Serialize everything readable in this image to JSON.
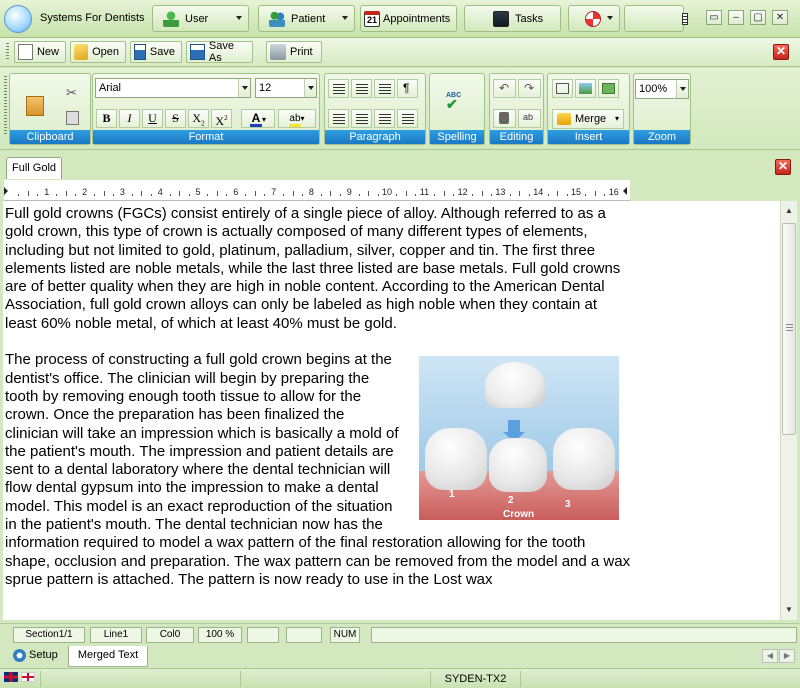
{
  "app": {
    "title": "Systems For Dentists",
    "menu": [
      {
        "label": "User",
        "icon": "user-icon"
      },
      {
        "label": "Patient",
        "icon": "patient-icon"
      },
      {
        "label": "Appointments",
        "icon": "calendar-icon",
        "calendar_day": "21"
      },
      {
        "label": "Tasks",
        "icon": "tasks-icon"
      }
    ]
  },
  "toolbar": {
    "new_label": "New",
    "open_label": "Open",
    "save_label": "Save",
    "save_as_label": "Save As",
    "print_label": "Print"
  },
  "ribbon": {
    "font_name": "Arial",
    "font_size": "12",
    "zoom_value": "100%",
    "merge_label": "Merge",
    "spelling_icon_text": "ABC",
    "groups": {
      "clipboard": "Clipboard",
      "format": "Format",
      "paragraph": "Paragraph",
      "spelling": "Spelling",
      "editing": "Editing",
      "insert": "Insert",
      "zoom": "Zoom"
    },
    "format_buttons": {
      "bold": "B",
      "italic": "I",
      "underline": "U",
      "strike": "S",
      "subscript": "X",
      "superscript": "X",
      "highlight": "ab"
    }
  },
  "document": {
    "tab_label": "Full Gold",
    "ruler_numbers": [
      "1",
      "2",
      "3",
      "4",
      "5",
      "6",
      "7",
      "8",
      "9",
      "10",
      "11",
      "12",
      "13",
      "14",
      "15",
      "16"
    ],
    "paragraph1": "Full gold crowns (FGCs) consist entirely of a single piece of alloy. Although referred to as a gold crown, this type of crown is actually composed of many different types of elements, including but not limited to gold, platinum, palladium, silver, copper and tin. The first three elements listed are noble metals, while the last three listed are base metals. Full gold crowns are of better quality when they are high in noble content. According to the American Dental Association, full gold crown alloys can only be labeled as high noble when they contain at least 60% noble metal, of which at least 40% must be gold.",
    "paragraph2": "The process of constructing a full gold crown begins at the dentist's office. The clinician will begin by preparing the tooth by removing enough tooth tissue to allow for the crown. Once the preparation has been finalized the clinician will take an impression which is basically a mold of the patient's mouth. The impression and patient details are sent to a dental laboratory where the dental technician will flow dental gypsum into the impression to make a dental model. This model is an exact reproduction of the situation in the patient's mouth. The dental technician now has the information required to model a wax pattern of the final restoration allowing for the tooth shape, occlusion and preparation. The wax pattern can be removed from the model and a wax sprue pattern is attached. The pattern is now ready to use in the Lost wax",
    "figure": {
      "label_1": "1",
      "label_2": "2",
      "label_3": "3",
      "caption": "Crown"
    }
  },
  "status": {
    "section": "Section1/1",
    "line": "Line1",
    "col": "Col0",
    "zoom": "100 %",
    "num": "NUM"
  },
  "bottom_tabs": [
    {
      "label": "Setup",
      "icon": "setup-icon"
    },
    {
      "label": "Merged Text"
    }
  ],
  "footer": {
    "server": "SYDEN-TX2"
  }
}
